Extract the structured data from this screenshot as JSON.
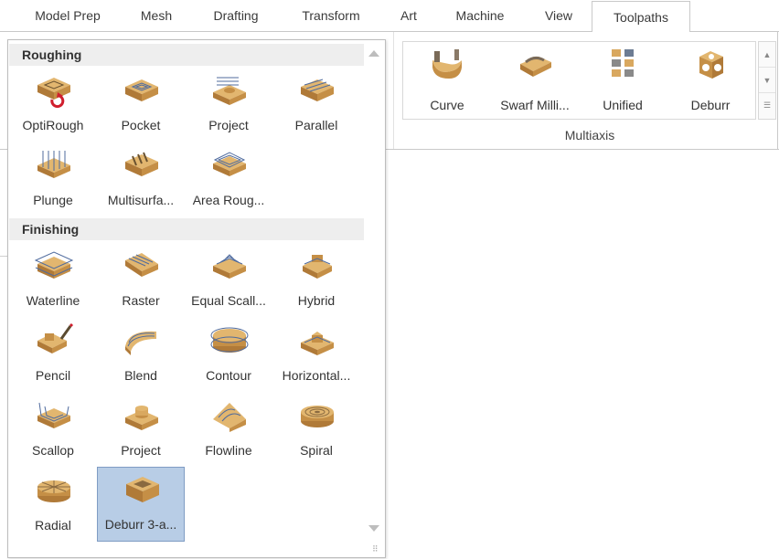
{
  "tabs": [
    "Model Prep",
    "Mesh",
    "Drafting",
    "Transform",
    "Art",
    "Machine",
    "View",
    "Toolpaths"
  ],
  "active_tab": "Toolpaths",
  "ribbon": {
    "gallery_items": [
      {
        "label": "Curve",
        "icon": "curve-icon"
      },
      {
        "label": "Swarf Milli...",
        "icon": "swarf-milling-icon"
      },
      {
        "label": "Unified",
        "icon": "unified-icon"
      },
      {
        "label": "Deburr",
        "icon": "deburr-icon"
      }
    ],
    "group_label": "Multiaxis"
  },
  "panel": {
    "sections": [
      {
        "title": "Roughing",
        "items": [
          {
            "label": "OptiRough",
            "icon": "optirough-icon"
          },
          {
            "label": "Pocket",
            "icon": "pocket-icon"
          },
          {
            "label": "Project",
            "icon": "project-icon"
          },
          {
            "label": "Parallel",
            "icon": "parallel-icon"
          },
          {
            "label": "Plunge",
            "icon": "plunge-icon"
          },
          {
            "label": "Multisurfa...",
            "icon": "multisurface-icon"
          },
          {
            "label": "Area Roug...",
            "icon": "area-roughing-icon"
          }
        ]
      },
      {
        "title": "Finishing",
        "items": [
          {
            "label": "Waterline",
            "icon": "waterline-icon"
          },
          {
            "label": "Raster",
            "icon": "raster-icon"
          },
          {
            "label": "Equal Scall...",
            "icon": "equal-scallop-icon"
          },
          {
            "label": "Hybrid",
            "icon": "hybrid-icon"
          },
          {
            "label": "Pencil",
            "icon": "pencil-icon"
          },
          {
            "label": "Blend",
            "icon": "blend-icon"
          },
          {
            "label": "Contour",
            "icon": "contour-icon"
          },
          {
            "label": "Horizontal...",
            "icon": "horizontal-icon"
          },
          {
            "label": "Scallop",
            "icon": "scallop-icon"
          },
          {
            "label": "Project",
            "icon": "project-finish-icon"
          },
          {
            "label": "Flowline",
            "icon": "flowline-icon"
          },
          {
            "label": "Spiral",
            "icon": "spiral-icon"
          },
          {
            "label": "Radial",
            "icon": "radial-icon"
          },
          {
            "label": "Deburr 3-a...",
            "icon": "deburr-3-axis-icon"
          }
        ]
      }
    ],
    "selected_item": "Deburr 3-a..."
  },
  "colors": {
    "selection_fill": "#b8cde6",
    "selection_border": "#7f9cc4",
    "stock_tan": "#d9a85f",
    "toolpath_blue": "#4f6b9e"
  }
}
